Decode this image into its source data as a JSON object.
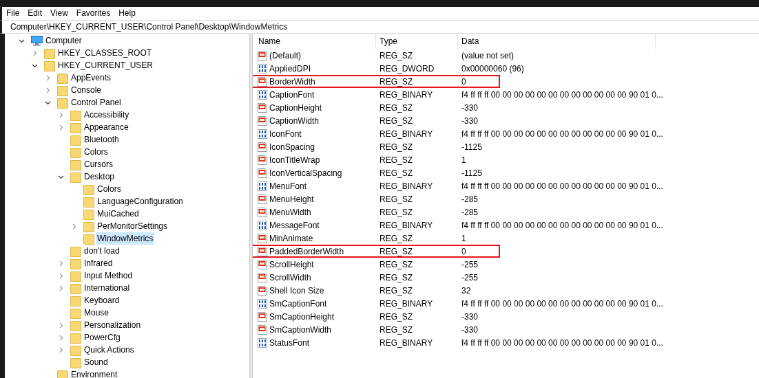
{
  "menu": [
    "File",
    "Edit",
    "View",
    "Favorites",
    "Help"
  ],
  "address": "Computer\\HKEY_CURRENT_USER\\Control Panel\\Desktop\\WindowMetrics",
  "tree": [
    {
      "label": "Computer",
      "kind": "computer",
      "expanded": true,
      "selected": false,
      "children": [
        {
          "label": "HKEY_CLASSES_ROOT",
          "kind": "folder",
          "expanded": false,
          "selected": false
        },
        {
          "label": "HKEY_CURRENT_USER",
          "kind": "folder",
          "expanded": true,
          "selected": false,
          "children": [
            {
              "label": "AppEvents",
              "kind": "folder",
              "expanded": false,
              "selected": false
            },
            {
              "label": "Console",
              "kind": "folder",
              "expanded": false,
              "selected": false
            },
            {
              "label": "Control Panel",
              "kind": "folder",
              "expanded": true,
              "selected": false,
              "children": [
                {
                  "label": "Accessibility",
                  "kind": "folder",
                  "expanded": false,
                  "selected": false
                },
                {
                  "label": "Appearance",
                  "kind": "folder",
                  "expanded": false,
                  "selected": false
                },
                {
                  "label": "Bluetooth",
                  "kind": "folder",
                  "selected": false
                },
                {
                  "label": "Colors",
                  "kind": "folder",
                  "selected": false
                },
                {
                  "label": "Cursors",
                  "kind": "folder",
                  "selected": false
                },
                {
                  "label": "Desktop",
                  "kind": "folder",
                  "expanded": true,
                  "selected": false,
                  "children": [
                    {
                      "label": "Colors",
                      "kind": "folder",
                      "selected": false
                    },
                    {
                      "label": "LanguageConfiguration",
                      "kind": "folder",
                      "selected": false
                    },
                    {
                      "label": "MuiCached",
                      "kind": "folder",
                      "selected": false
                    },
                    {
                      "label": "PerMonitorSettings",
                      "kind": "folder",
                      "expanded": false,
                      "selected": false
                    },
                    {
                      "label": "WindowMetrics",
                      "kind": "folder",
                      "selected": true
                    }
                  ]
                },
                {
                  "label": "don't load",
                  "kind": "folder",
                  "selected": false
                },
                {
                  "label": "Infrared",
                  "kind": "folder",
                  "expanded": false,
                  "selected": false
                },
                {
                  "label": "Input Method",
                  "kind": "folder",
                  "expanded": false,
                  "selected": false
                },
                {
                  "label": "International",
                  "kind": "folder",
                  "expanded": false,
                  "selected": false
                },
                {
                  "label": "Keyboard",
                  "kind": "folder",
                  "selected": false
                },
                {
                  "label": "Mouse",
                  "kind": "folder",
                  "selected": false
                },
                {
                  "label": "Personalization",
                  "kind": "folder",
                  "expanded": false,
                  "selected": false
                },
                {
                  "label": "PowerCfg",
                  "kind": "folder",
                  "expanded": false,
                  "selected": false
                },
                {
                  "label": "Quick Actions",
                  "kind": "folder",
                  "expanded": false,
                  "selected": false
                },
                {
                  "label": "Sound",
                  "kind": "folder",
                  "selected": false
                }
              ]
            },
            {
              "label": "Environment",
              "kind": "folder",
              "selected": false
            }
          ]
        }
      ]
    }
  ],
  "columns": [
    "Name",
    "Type",
    "Data"
  ],
  "values": [
    {
      "name": "(Default)",
      "kind": "string",
      "type": "REG_SZ",
      "data": "(value not set)",
      "highlighted": false
    },
    {
      "name": "AppliedDPI",
      "kind": "binary",
      "type": "REG_DWORD",
      "data": "0x00000060 (96)",
      "highlighted": false
    },
    {
      "name": "BorderWidth",
      "kind": "string",
      "type": "REG_SZ",
      "data": "0",
      "highlighted": true
    },
    {
      "name": "CaptionFont",
      "kind": "binary",
      "type": "REG_BINARY",
      "data": "f4 ff ff ff 00 00 00 00 00 00 00 00 00 00 00 00 90 01 0...",
      "highlighted": false
    },
    {
      "name": "CaptionHeight",
      "kind": "string",
      "type": "REG_SZ",
      "data": "-330",
      "highlighted": false
    },
    {
      "name": "CaptionWidth",
      "kind": "string",
      "type": "REG_SZ",
      "data": "-330",
      "highlighted": false
    },
    {
      "name": "IconFont",
      "kind": "binary",
      "type": "REG_BINARY",
      "data": "f4 ff ff ff 00 00 00 00 00 00 00 00 00 00 00 00 90 01 0...",
      "highlighted": false
    },
    {
      "name": "IconSpacing",
      "kind": "string",
      "type": "REG_SZ",
      "data": "-1125",
      "highlighted": false
    },
    {
      "name": "IconTitleWrap",
      "kind": "string",
      "type": "REG_SZ",
      "data": "1",
      "highlighted": false
    },
    {
      "name": "IconVerticalSpacing",
      "kind": "string",
      "type": "REG_SZ",
      "data": "-1125",
      "highlighted": false
    },
    {
      "name": "MenuFont",
      "kind": "binary",
      "type": "REG_BINARY",
      "data": "f4 ff ff ff 00 00 00 00 00 00 00 00 00 00 00 00 90 01 0...",
      "highlighted": false
    },
    {
      "name": "MenuHeight",
      "kind": "string",
      "type": "REG_SZ",
      "data": "-285",
      "highlighted": false
    },
    {
      "name": "MenuWidth",
      "kind": "string",
      "type": "REG_SZ",
      "data": "-285",
      "highlighted": false
    },
    {
      "name": "MessageFont",
      "kind": "binary",
      "type": "REG_BINARY",
      "data": "f4 ff ff ff 00 00 00 00 00 00 00 00 00 00 00 00 90 01 0...",
      "highlighted": false
    },
    {
      "name": "MinAnimate",
      "kind": "string",
      "type": "REG_SZ",
      "data": "1",
      "highlighted": false
    },
    {
      "name": "PaddedBorderWidth",
      "kind": "string",
      "type": "REG_SZ",
      "data": "0",
      "highlighted": true
    },
    {
      "name": "ScrollHeight",
      "kind": "string",
      "type": "REG_SZ",
      "data": "-255",
      "highlighted": false
    },
    {
      "name": "ScrollWidth",
      "kind": "string",
      "type": "REG_SZ",
      "data": "-255",
      "highlighted": false
    },
    {
      "name": "Shell Icon Size",
      "kind": "string",
      "type": "REG_SZ",
      "data": "32",
      "highlighted": false
    },
    {
      "name": "SmCaptionFont",
      "kind": "binary",
      "type": "REG_BINARY",
      "data": "f4 ff ff ff 00 00 00 00 00 00 00 00 00 00 00 00 90 01 0...",
      "highlighted": false
    },
    {
      "name": "SmCaptionHeight",
      "kind": "string",
      "type": "REG_SZ",
      "data": "-330",
      "highlighted": false
    },
    {
      "name": "SmCaptionWidth",
      "kind": "string",
      "type": "REG_SZ",
      "data": "-330",
      "highlighted": false
    },
    {
      "name": "StatusFont",
      "kind": "binary",
      "type": "REG_BINARY",
      "data": "f4 ff ff ff 00 00 00 00 00 00 00 00 00 00 00 00 90 01 0...",
      "highlighted": false
    }
  ]
}
